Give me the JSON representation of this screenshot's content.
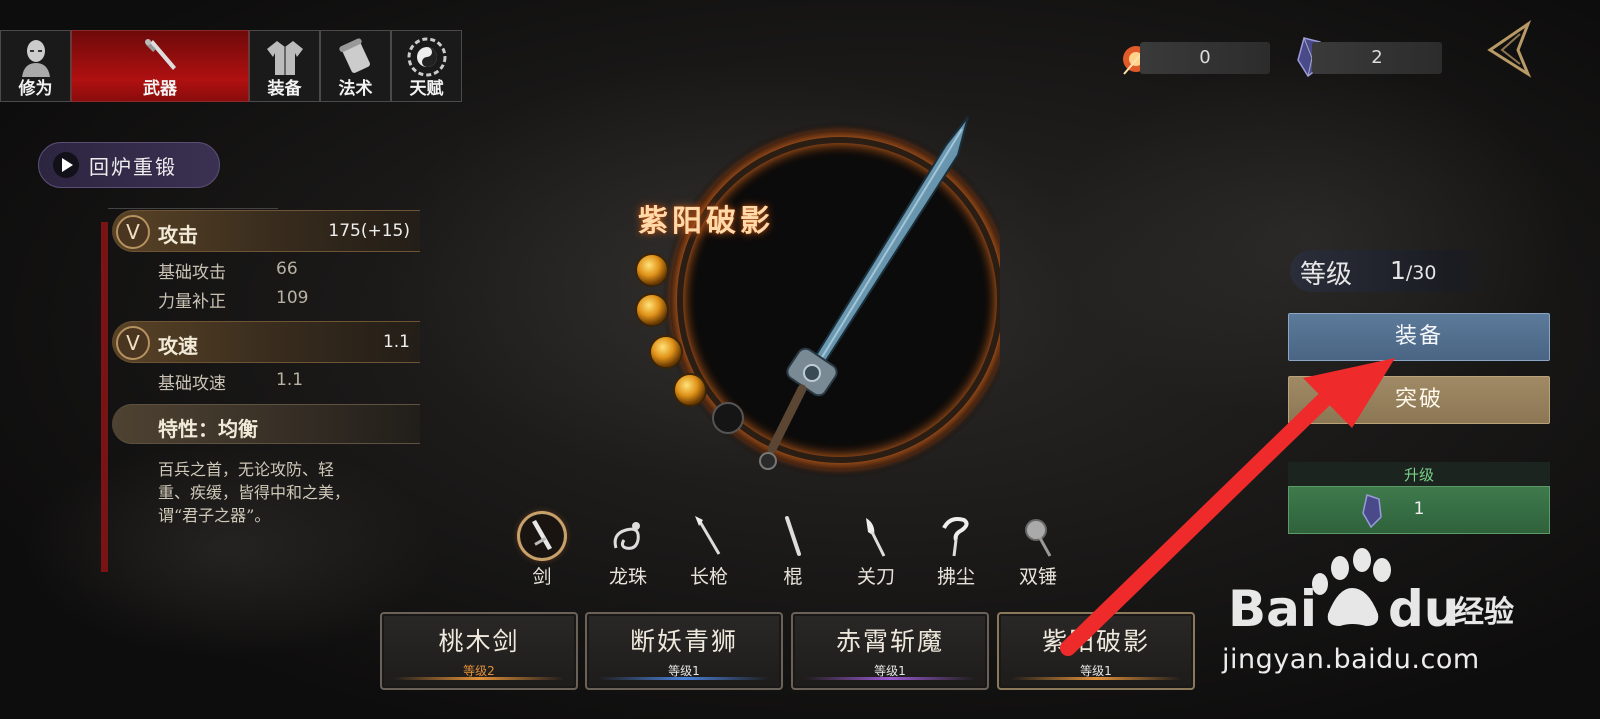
{
  "tabs": [
    {
      "label": "修为",
      "icon": "cultivator-icon"
    },
    {
      "label": "武器",
      "icon": "sword-icon",
      "active": true
    },
    {
      "label": "装备",
      "icon": "robe-icon"
    },
    {
      "label": "法术",
      "icon": "scroll-icon"
    },
    {
      "label": "天赋",
      "icon": "bagua-icon"
    }
  ],
  "currency": [
    {
      "icon": "fire-orb-icon",
      "value": "0"
    },
    {
      "icon": "crystal-icon",
      "value": "2"
    }
  ],
  "reforge_label": "回炉重锻",
  "stats": {
    "attack": {
      "label": "攻击",
      "value": "175(+15)",
      "toggle": "V"
    },
    "base_attack": {
      "label": "基础攻击",
      "value": "66"
    },
    "strength_bonus": {
      "label": "力量补正",
      "value": "109"
    },
    "speed": {
      "label": "攻速",
      "value": "1.1",
      "toggle": "V"
    },
    "base_speed": {
      "label": "基础攻速",
      "value": "1.1"
    },
    "trait": "特性：均衡",
    "description": "百兵之首，无论攻防、轻重、疾缓，皆得中和之美，谓“君子之器”。"
  },
  "weapon_name": "紫阳破影",
  "orbs_filled": 4,
  "orbs_total": 5,
  "categories": [
    {
      "label": "剑",
      "icon": "sword-category-icon",
      "active": true
    },
    {
      "label": "龙珠",
      "icon": "dragon-orb-icon"
    },
    {
      "label": "长枪",
      "icon": "spear-icon"
    },
    {
      "label": "棍",
      "icon": "staff-icon"
    },
    {
      "label": "关刀",
      "icon": "guandao-icon"
    },
    {
      "label": "拂尘",
      "icon": "whisk-icon"
    },
    {
      "label": "双锤",
      "icon": "hammers-icon"
    }
  ],
  "weapons": [
    {
      "name": "桃木剑",
      "level": "等级2",
      "color": "#e0903a"
    },
    {
      "name": "断妖青狮",
      "level": "等级1",
      "color": "#4a80d8"
    },
    {
      "name": "赤霄斩魔",
      "level": "等级1",
      "color": "#9a5ad0"
    },
    {
      "name": "紫阳破影",
      "level": "等级1",
      "color": "#e0903a"
    }
  ],
  "level": {
    "label": "等级",
    "current": "1",
    "max": "/30"
  },
  "equip_label": "装备",
  "breakthrough_label": "突破",
  "upgrade": {
    "title": "升级",
    "cost": "1"
  },
  "watermark": {
    "logo": "Bai du 经验",
    "url": "jingyan.baidu.com"
  },
  "colors": {
    "accent_red": "#b01010",
    "equip_blue": "#4a6584",
    "upgrade_green": "#2f623b",
    "gold": "#c8a06a"
  }
}
